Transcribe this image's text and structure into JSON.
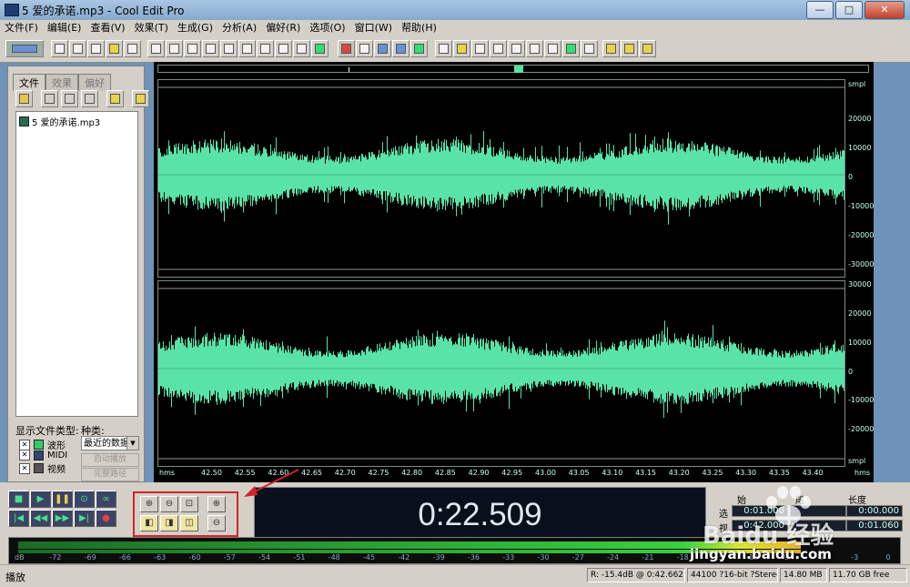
{
  "window": {
    "title": "5 爱的承诺.mp3 - Cool Edit Pro",
    "btn_min": "—",
    "btn_max": "□",
    "btn_close": "✕"
  },
  "menu": [
    "文件(F)",
    "编辑(E)",
    "查看(V)",
    "效果(T)",
    "生成(G)",
    "分析(A)",
    "偏好(R)",
    "选项(O)",
    "窗口(W)",
    "帮助(H)"
  ],
  "left_panel": {
    "tabs": [
      "文件",
      "效果",
      "偏好"
    ],
    "files": [
      "5 爱的承诺.mp3"
    ],
    "filetypes_label": "显示文件类型:",
    "category_label": "种类:",
    "filetypes": [
      "波形",
      "MIDI",
      "视频"
    ],
    "category_value": "最近的数据",
    "btn_autoplay": "自动播放",
    "btn_fullpath": "完整路径"
  },
  "colors": {
    "waveform": "#5ae3a8",
    "background": "#000000",
    "annotation": "#d1242a"
  },
  "editor": {
    "top_unit": "smpl",
    "bottom_unit": "smpl",
    "ch1_labels": [
      "20000",
      "10000",
      "0",
      "-10000",
      "-20000",
      "-30000"
    ],
    "ch2_labels": [
      "30000",
      "20000",
      "10000",
      "0",
      "-10000",
      "-20000"
    ],
    "time_labels": [
      "42.50",
      "42.55",
      "42.60",
      "42.65",
      "42.70",
      "42.75",
      "42.80",
      "42.85",
      "42.90",
      "42.95",
      "43.00",
      "43.05",
      "43.10",
      "43.15",
      "43.20",
      "43.25",
      "43.30",
      "43.35",
      "43.40"
    ],
    "hms_left": "hms",
    "hms_right": "hms"
  },
  "transport": {
    "current_time": "0:22.509"
  },
  "selection": {
    "hdr_begin": "始",
    "hdr_end": "尾",
    "hdr_length": "长度",
    "row_sel": "选",
    "row_view": "视",
    "sel_begin": "0:01.000",
    "sel_end": "",
    "sel_length": "0:00.000",
    "view_begin": "0:42.000",
    "view_end": "",
    "view_length": "0:01.060"
  },
  "level_meter": {
    "labels": [
      "dB",
      "-72",
      "-69",
      "-66",
      "-63",
      "-60",
      "-57",
      "-54",
      "-51",
      "-48",
      "-45",
      "-42",
      "-39",
      "-36",
      "-33",
      "-30",
      "-27",
      "-24",
      "-21",
      "-18",
      "-15",
      "-12",
      "-9",
      "-6",
      "-3",
      "0"
    ],
    "level_fraction": 0.9
  },
  "status": {
    "left": "播放",
    "cursor": "R: -15.4dB @   0:42.662",
    "format": "44100 ?16-bit ?Stereo",
    "size": "14.80 MB",
    "free": "11.70 GB free"
  },
  "watermark": {
    "text": "Baidu 经验",
    "url": "jingyan.baidu.com"
  }
}
